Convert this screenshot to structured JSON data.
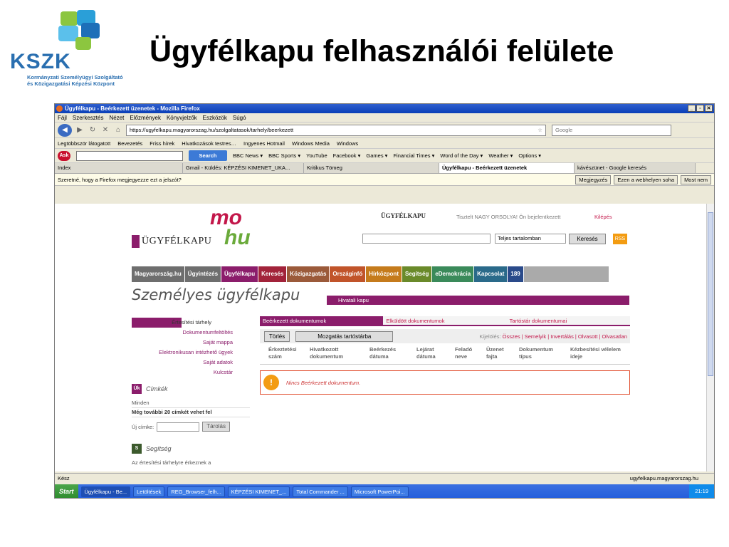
{
  "slide": {
    "logo_text": "KSZK",
    "logo_subtitle_1": "Kormányzati Személyügyi Szolgáltató",
    "logo_subtitle_2": "és Közigazgatási Képzési Központ",
    "title": "Ügyfélkapu felhasználói felülete"
  },
  "browser": {
    "window_title": "Ügyfélkapu - Beérkezett üzenetek - Mozilla Firefox",
    "menu": [
      "Fájl",
      "Szerkesztés",
      "Nézet",
      "Előzmények",
      "Könyvjelzők",
      "Eszközök",
      "Súgó"
    ],
    "url": "https://ugyfelkapu.magyarorszag.hu/szolgaltatasok/tarhely/beerkezett",
    "search_placeholder": "Google",
    "bookmarks": [
      "Legtöbbször látogatott",
      "Bevezetés",
      "Friss hírek",
      "Hivatkozások testres…",
      "Ingyenes Hotmail",
      "Windows Media",
      "Windows"
    ],
    "ask_search_button": "Search",
    "ask_items": [
      "BBC News ▾",
      "BBC Sports ▾",
      "YouTube",
      "Facebook ▾",
      "Games ▾",
      "Financial Times ▾",
      "Word of the Day ▾",
      "Weather ▾",
      "Options ▾"
    ],
    "tabs": [
      "Index",
      "Gmail - Küldés: KÉPZÉSI KIMENET_UKA...",
      "Kritikus Tömeg",
      "Ügyfélkapu - Beérkezett üzenetek",
      "kávészünet - Google keresés"
    ],
    "password_prompt": "Szeretné, hogy a Firefox megjegyezze ezt a jelszót?",
    "prompt_buttons": [
      "Megjegyzés",
      "Ezen a webhelyen soha",
      "Most nem"
    ],
    "status_left": "Kész",
    "status_right": "ugyfelkapu.magyarorszag.hu"
  },
  "site": {
    "brand": "ÜGYFÉLKAPU",
    "mohu_top": "mo",
    "mohu_bottom": "hu",
    "header_brand": "ÜGYFÉLKAPU",
    "user_info": "Tisztelt NAGY ORSOLYA! Ön bejelentkezett",
    "logout": "Kilépés",
    "scope": "Teljes tartalomban",
    "search_button": "Keresés",
    "nav": [
      "Magyarország.hu",
      "Ügyintézés",
      "Ügyfélkapu",
      "Keresés",
      "Közigazgatás",
      "Országinfó",
      "Hírközpont",
      "Segítség",
      "eDemokrácia",
      "Kapcsolat",
      "189"
    ],
    "page_title": "Személyes ügyfélkapu",
    "hivatali_kapu": "Hivatali kapu",
    "side_menu": [
      "Értesítési tárhely",
      "Dokumentumfeltöltés",
      "Saját mappa",
      "Elektronikusan intézhető ügyek",
      "Saját adatok",
      "Kulcstár"
    ],
    "labels_panel": {
      "badge": "Ük",
      "title": "Címkék",
      "line1": "Minden",
      "line2": "Még további 20 címkét vehet fel",
      "new_label": "Új címke:",
      "add_button": "Tárolás"
    },
    "help_panel": {
      "badge": "S",
      "title": "Segítség",
      "text": "Az értesítési tárhelyre érkeznek a"
    },
    "message_tabs": [
      "Beérkezett dokumentumok",
      "Elküldött dokumentumok",
      "Tartóstár dokumentumai"
    ],
    "delete_button": "Törlés",
    "move_button": "Mozgatás tartóstárba",
    "selection_label": "Kijelölés:",
    "selection_options": "Összes | Semelyik | Invertálás | Olvasott | Olvasatlan",
    "columns": [
      "Érkeztetési szám",
      "Hivatkozott dokumentum",
      "Beérkezés dátuma",
      "Lejárat dátuma",
      "Feladó neve",
      "Üzenet fajta",
      "Dokumentum típus",
      "Kézbesítési vélelem ideje"
    ],
    "empty_message": "Nincs Beérkezett dokumentum."
  },
  "taskbar": {
    "start": "Start",
    "items": [
      "Ügyfélkapu - Be...",
      "Letöltések",
      "REG_Browser_felh...",
      "KÉPZÉSI KIMENET_...",
      "Total Commander ...",
      "Microsoft PowerPoi..."
    ],
    "clock": "21:19"
  },
  "colors": {
    "brand_purple": "#8b1d6b",
    "brand_red": "#c3174a",
    "brand_green": "#6aaa3a",
    "kszk_blue": "#2a6fb0"
  }
}
